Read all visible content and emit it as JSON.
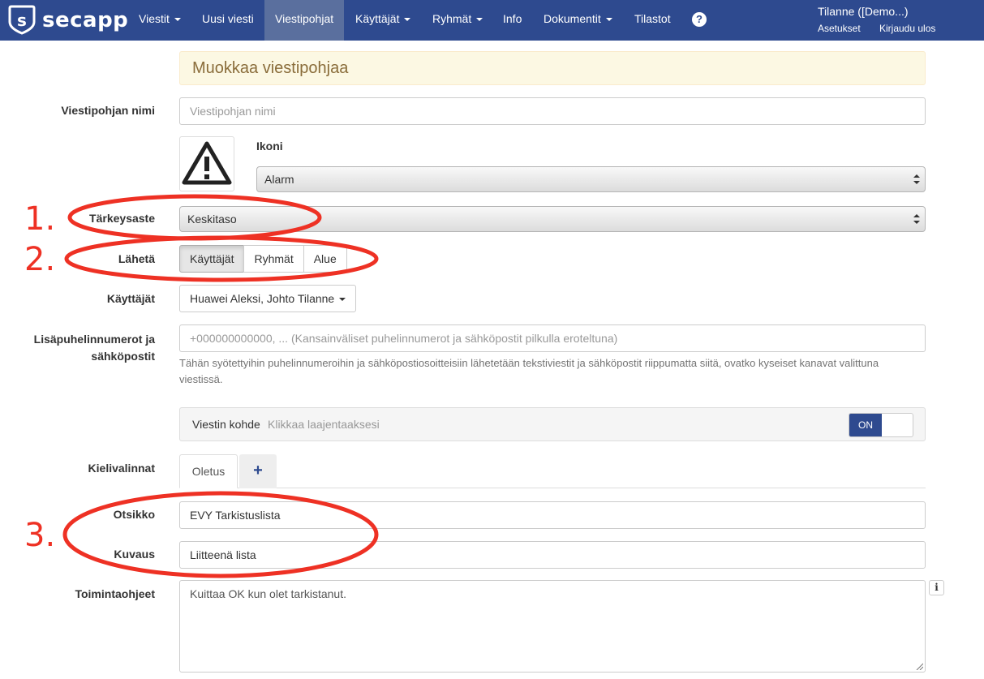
{
  "brand": {
    "name": "secapp",
    "logo_icon": "shield-s-logo-icon"
  },
  "nav": {
    "items": [
      {
        "label": "Viestit",
        "dropdown": true
      },
      {
        "label": "Uusi viesti",
        "dropdown": false
      },
      {
        "label": "Viestipohjat",
        "dropdown": false,
        "active": true
      },
      {
        "label": "Käyttäjät",
        "dropdown": true
      },
      {
        "label": "Ryhmät",
        "dropdown": true
      },
      {
        "label": "Info",
        "dropdown": false
      },
      {
        "label": "Dokumentit",
        "dropdown": true
      },
      {
        "label": "Tilastot",
        "dropdown": false
      }
    ],
    "help_icon": "?",
    "user": {
      "name": "Tilanne  ([Demo...)",
      "settings": "Asetukset",
      "logout": "Kirjaudu ulos"
    }
  },
  "form": {
    "title": "Muokkaa viestipohjaa",
    "template_name": {
      "label": "Viestipohjan nimi",
      "value": "",
      "placeholder": "Viestipohjan nimi"
    },
    "icon": {
      "label": "Ikoni",
      "selected": "Alarm",
      "icon_name": "warning-triangle-icon"
    },
    "priority": {
      "label": "Tärkeysaste",
      "selected": "Keskitaso"
    },
    "send": {
      "label": "Lähetä",
      "options": [
        "Käyttäjät",
        "Ryhmät",
        "Alue"
      ],
      "active_index": 0
    },
    "users": {
      "label": "Käyttäjät",
      "selected": "Huawei Aleksi, Johto Tilanne"
    },
    "extra_contacts": {
      "label_line1": "Lisäpuhelinnumerot ja",
      "label_line2": "sähköpostit",
      "placeholder": "+000000000000, ... (Kansainväliset puhelinnumerot ja sähköpostit pilkulla eroteltuna)",
      "help": "Tähän syötettyihin puhelinnumeroihin ja sähköpostiosoitteisiin lähetetään tekstiviestit ja sähköpostit riippumatta siitä, ovatko kyseiset kanavat valittuna viestissä."
    },
    "target_panel": {
      "title": "Viestin kohde",
      "hint": "Klikkaa laajentaaksesi",
      "toggle": "ON"
    },
    "languages": {
      "label": "Kielivalinnat",
      "tabs": [
        "Oletus"
      ],
      "add": "+"
    },
    "subject": {
      "label": "Otsikko",
      "value": "EVY Tarkistuslista"
    },
    "description": {
      "label": "Kuvaus",
      "value": "Liitteenä lista"
    },
    "instructions": {
      "label": "Toimintaohjeet",
      "value": "Kuittaa OK kun olet tarkistanut.",
      "info": "i"
    }
  },
  "annotations": {
    "color": "#ee3124",
    "numbers": [
      "1.",
      "2.",
      "3."
    ]
  },
  "colors": {
    "navbar": "#2e4a8f",
    "active_nav": "#5a6f9e",
    "warning_bg": "#fcf8e3",
    "warning_text": "#8a6d3b"
  }
}
